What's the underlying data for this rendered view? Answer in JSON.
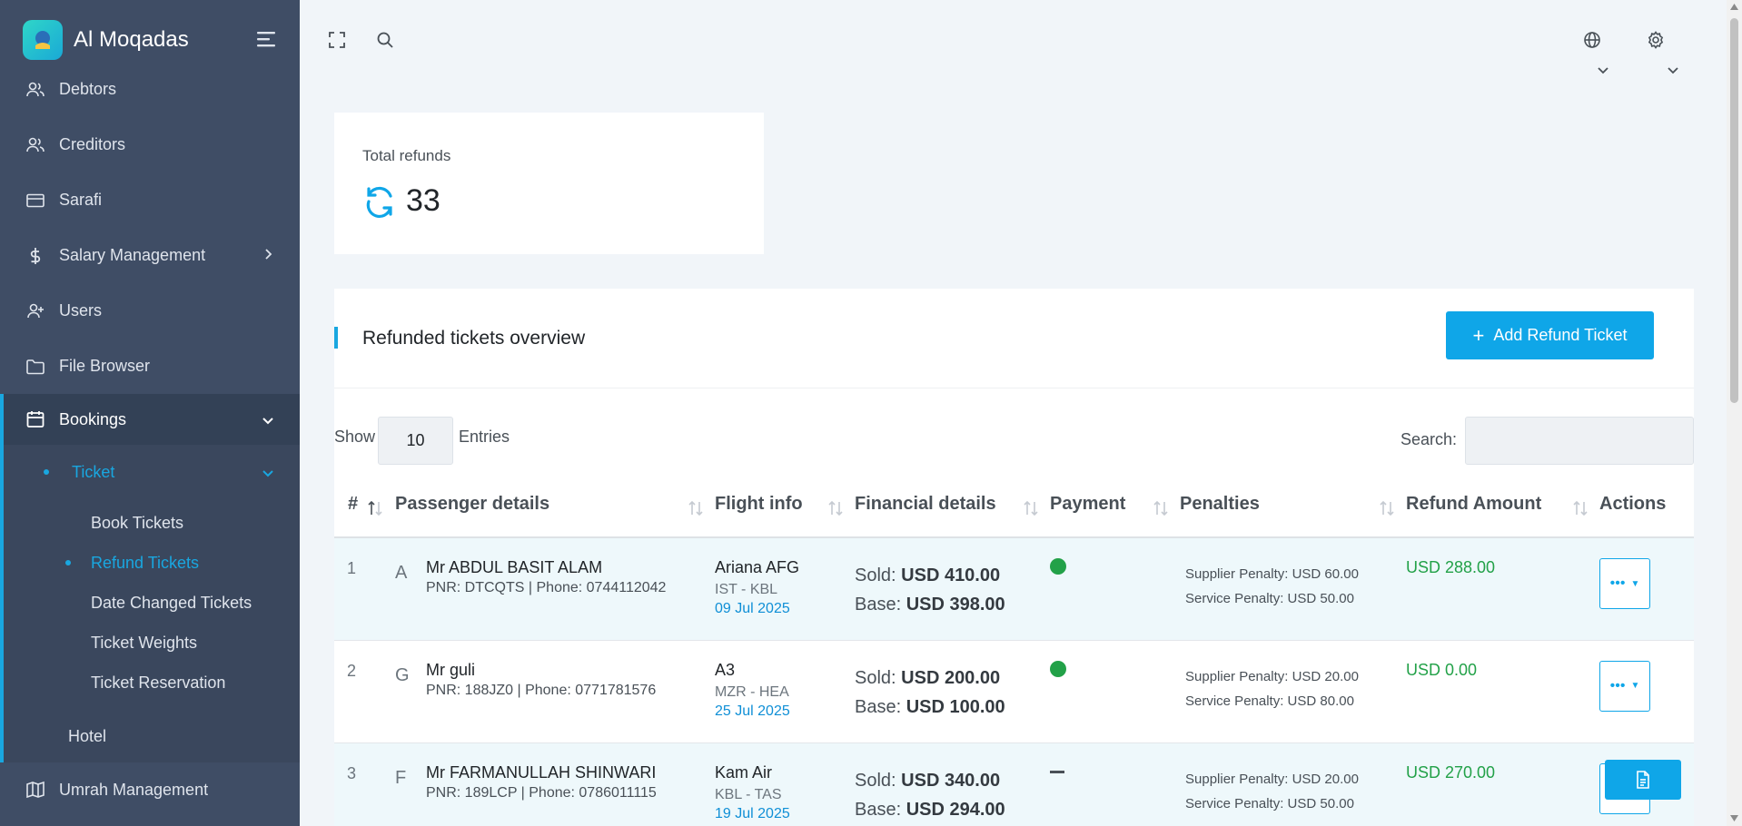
{
  "brand": {
    "name": "Al Moqadas"
  },
  "sidebar": {
    "items": [
      {
        "label": "Debtors",
        "icon": "users-icon"
      },
      {
        "label": "Creditors",
        "icon": "users-icon"
      },
      {
        "label": "Sarafi",
        "icon": "credit-card-icon"
      },
      {
        "label": "Salary Management",
        "icon": "dollar-icon"
      },
      {
        "label": "Users",
        "icon": "user-plus-icon"
      },
      {
        "label": "File Browser",
        "icon": "folder-icon"
      },
      {
        "label": "Bookings",
        "icon": "calendar-icon"
      }
    ],
    "ticket": {
      "label": "Ticket",
      "children": [
        "Book Tickets",
        "Refund Tickets",
        "Date Changed Tickets",
        "Ticket Weights",
        "Ticket Reservation"
      ]
    },
    "hotel": "Hotel",
    "after": "Umrah Management"
  },
  "stats": {
    "label": "Total refunds",
    "value": "33"
  },
  "card": {
    "title": "Refunded tickets overview",
    "add_button": "Add Refund Ticket"
  },
  "controls": {
    "show": "Show",
    "entries_value": "10",
    "entries": "Entries",
    "search": "Search:"
  },
  "table": {
    "headers": [
      "#",
      "Passenger details",
      "Flight info",
      "Financial details",
      "Payment",
      "Penalties",
      "Refund Amount",
      "Actions"
    ],
    "rows": [
      {
        "idx": "1",
        "initial": "A",
        "name": "Mr ABDUL BASIT ALAM",
        "meta": "PNR: DTCQTS | Phone: 0744112042",
        "airline": "Ariana AFG",
        "route": "IST - KBL",
        "date": "09 Jul 2025",
        "sold_label": "Sold:",
        "sold": "USD 410.00",
        "base_label": "Base:",
        "base": "USD 398.00",
        "payment": "paid",
        "supplier_penalty": "Supplier Penalty: USD 60.00",
        "service_penalty": "Service Penalty: USD 50.00",
        "refund": "USD 288.00"
      },
      {
        "idx": "2",
        "initial": "G",
        "name": "Mr guli",
        "meta": "PNR: 188JZ0 | Phone: 0771781576",
        "airline": "A3",
        "route": "MZR - HEA",
        "date": "25 Jul 2025",
        "sold_label": "Sold:",
        "sold": "USD 200.00",
        "base_label": "Base:",
        "base": "USD 100.00",
        "payment": "paid",
        "supplier_penalty": "Supplier Penalty: USD 20.00",
        "service_penalty": "Service Penalty: USD 80.00",
        "refund": "USD 0.00"
      },
      {
        "idx": "3",
        "initial": "F",
        "name": "Mr FARMANULLAH SHINWARI",
        "meta": "PNR: 189LCP | Phone: 0786011115",
        "airline": "Kam Air",
        "route": "KBL - TAS",
        "date": "19 Jul 2025",
        "sold_label": "Sold:",
        "sold": "USD 340.00",
        "base_label": "Base:",
        "base": "USD 294.00",
        "payment": "none",
        "supplier_penalty": "Supplier Penalty: USD 20.00",
        "service_penalty": "Service Penalty: USD 50.00",
        "refund": "USD 270.00"
      }
    ]
  },
  "colors": {
    "accent": "#0fa6e8",
    "sidebar": "#3f4d65",
    "success": "#22a148"
  }
}
